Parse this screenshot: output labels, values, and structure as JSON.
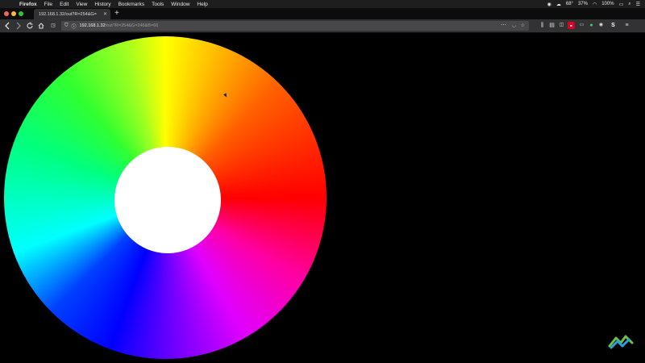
{
  "menubar": {
    "app": "Firefox",
    "items": [
      "File",
      "Edit",
      "View",
      "History",
      "Bookmarks",
      "Tools",
      "Window",
      "Help"
    ],
    "status": {
      "temp": "68°",
      "battery_pct": "37%",
      "volume": "100%"
    }
  },
  "tab": {
    "title": "192.168.1.32/out?R=254&G=246&B=66"
  },
  "url": {
    "host": "192.168.1.32",
    "path": "/out?R=254&G=246&B=66"
  },
  "colors": {
    "accent": "#0060df",
    "close": "#ff5f57",
    "minimize": "#febc2e",
    "maximize": "#28c840"
  },
  "icons": [
    "apple-icon",
    "back-icon",
    "forward-icon",
    "reload-icon",
    "home-icon",
    "shield-icon",
    "lock-icon",
    "library-icon",
    "sidebar-icon",
    "menu-icon",
    "instructables-logo-icon"
  ]
}
